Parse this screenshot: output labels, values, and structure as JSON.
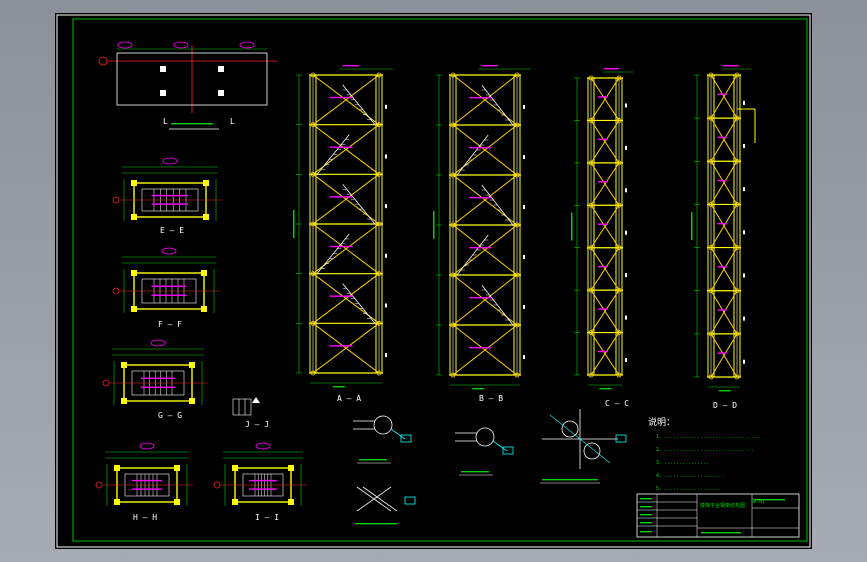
{
  "colors": {
    "background": "#000000",
    "frame_outer": "#ffffff",
    "frame_inner": "#00c000",
    "steel": "#ffff00",
    "bracing": "#ffd200",
    "dimension": "#ff00ff",
    "annotation": "#00d000",
    "axis": "#ff2020",
    "detail": "#00ffff"
  },
  "views": {
    "a": "A — A",
    "b": "B — B",
    "c": "C — C",
    "d": "D — D",
    "e": "E — E",
    "f": "F — F",
    "g": "G — G",
    "h": "H — H",
    "i": "I — I",
    "j": "J — J"
  },
  "plan": {
    "left_tag": "L",
    "right_tag": "L"
  },
  "notes": {
    "title": "说明：",
    "lines": [
      "1、................................",
      "2、..............................",
      "3、...............",
      "4、....................",
      "5、..................."
    ]
  },
  "title_block": {
    "drawing_title": "楼梯平台钢架结构图",
    "drawing_no": "梯-01"
  },
  "icons": [
    "north-arrow-icon",
    "weld-symbol-icon"
  ]
}
